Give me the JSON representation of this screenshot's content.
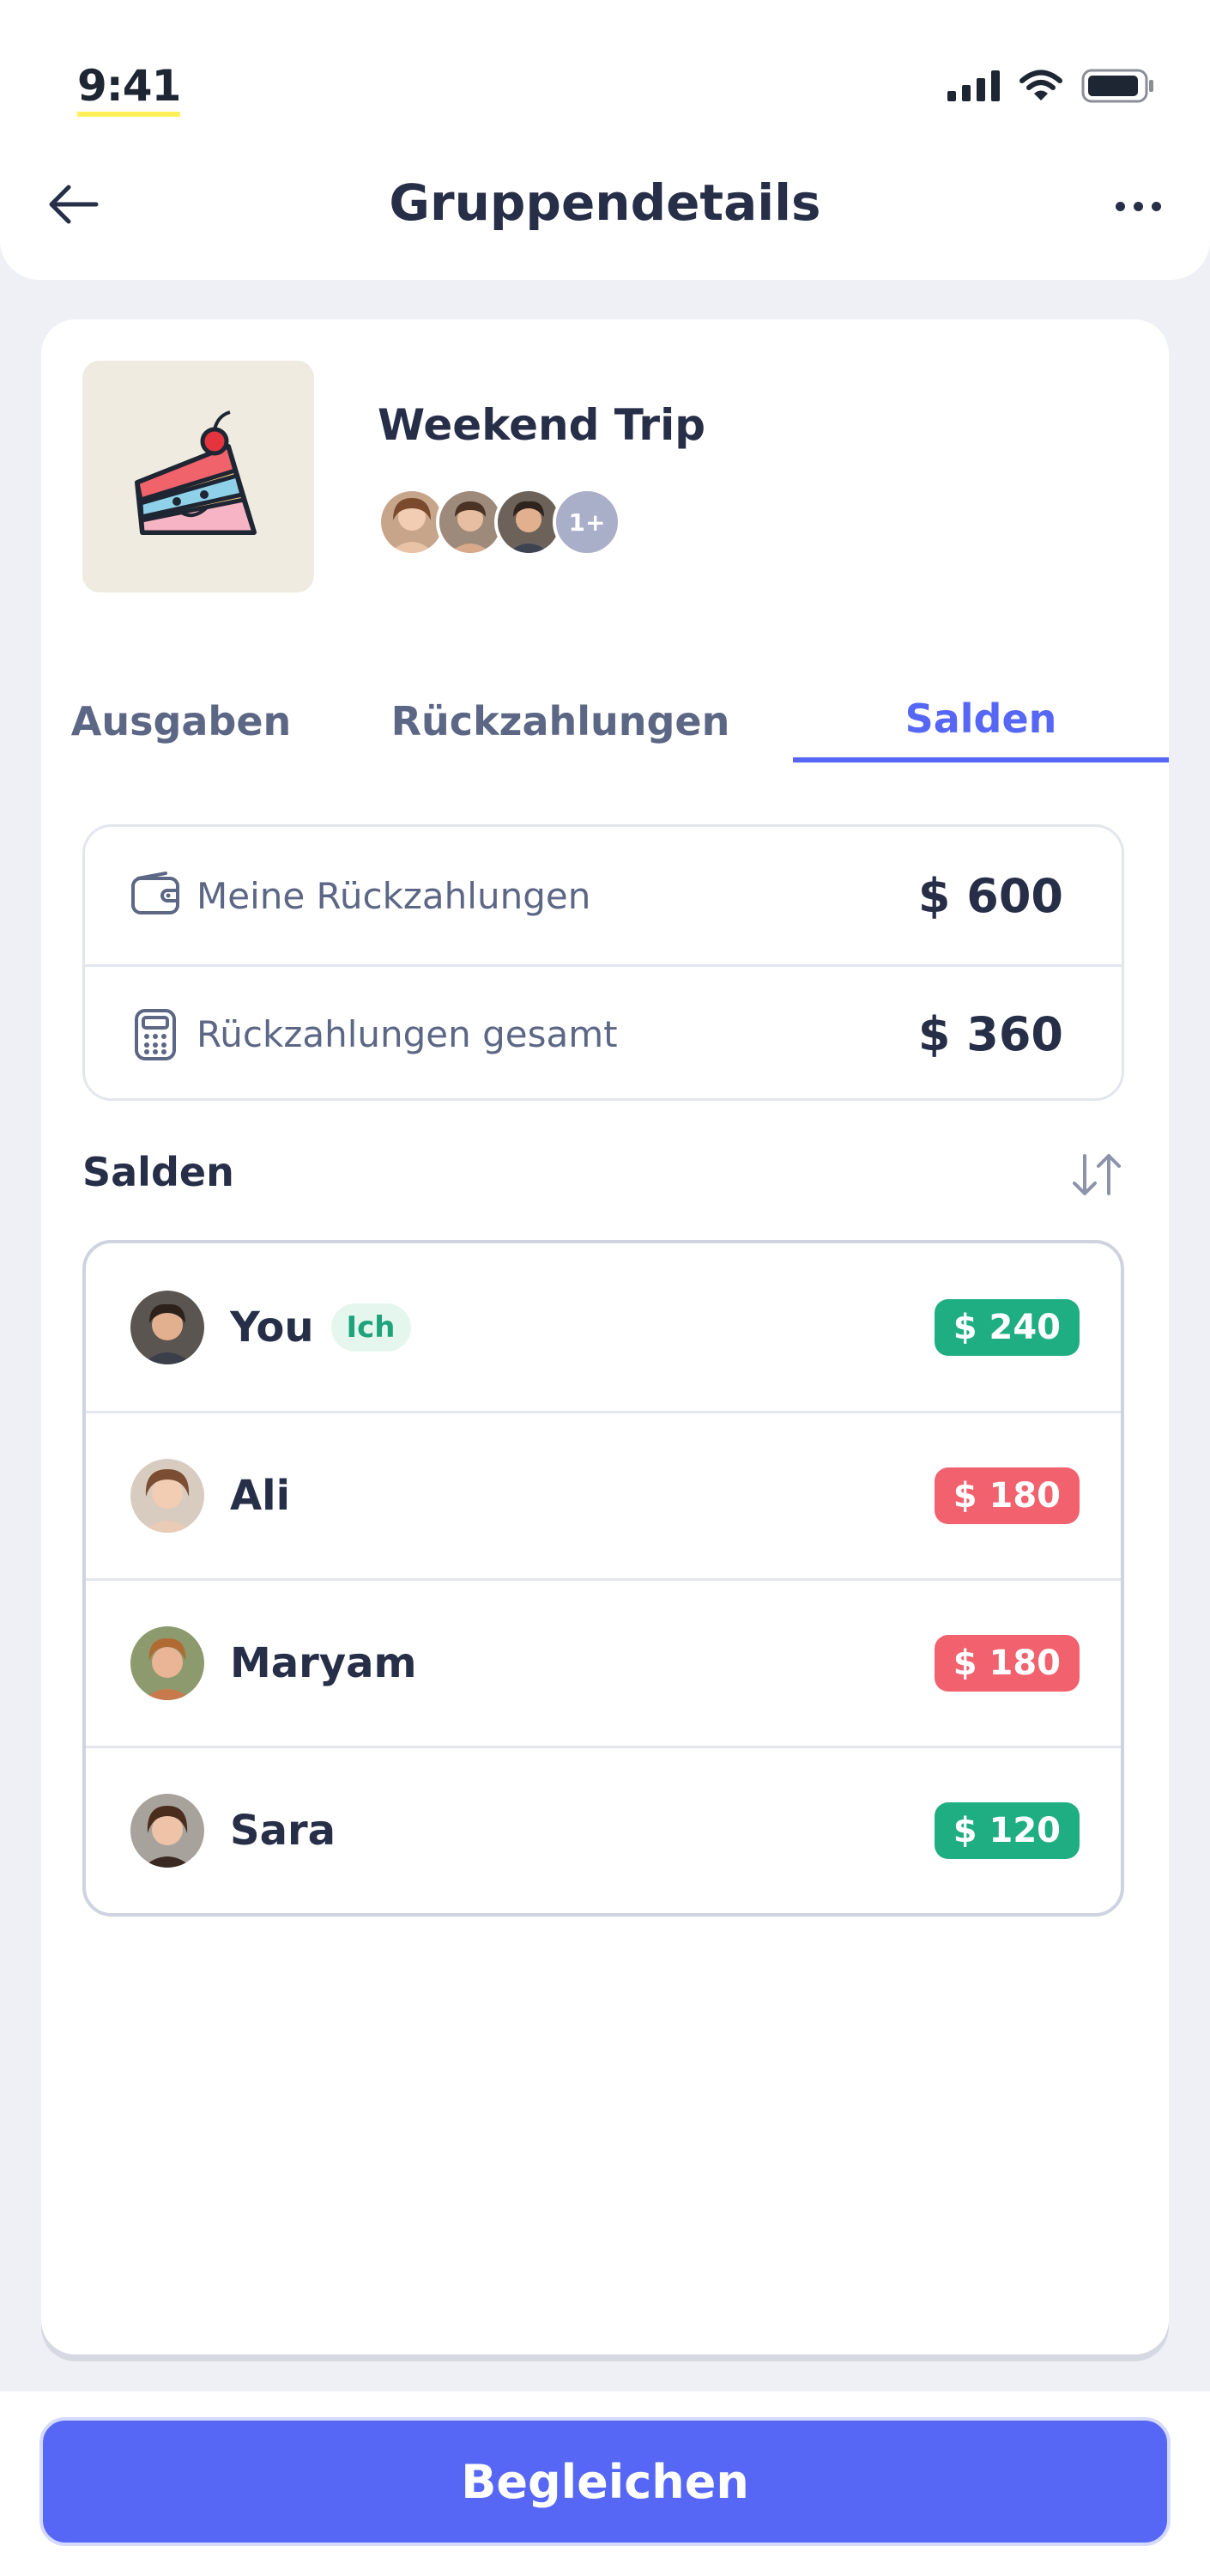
{
  "status_bar": {
    "time": "9:41"
  },
  "header": {
    "title": "Gruppendetails"
  },
  "group": {
    "name": "Weekend Trip",
    "more_members_label": "1+"
  },
  "tabs": [
    {
      "label": "Ausgaben",
      "active": false
    },
    {
      "label": "Rückzahlungen",
      "active": false
    },
    {
      "label": "Salden",
      "active": true
    }
  ],
  "summary": [
    {
      "label": "Meine Rückzahlungen",
      "value": "$ 600",
      "icon": "wallet-icon"
    },
    {
      "label": "Rückzahlungen gesamt",
      "value": "$ 360",
      "icon": "calculator-icon"
    }
  ],
  "balances_section": {
    "title": "Salden"
  },
  "balances": [
    {
      "name": "You",
      "badge": "Ich",
      "amount": "$ 240",
      "status": "positive"
    },
    {
      "name": "Ali",
      "badge": "",
      "amount": "$ 180",
      "status": "negative"
    },
    {
      "name": "Maryam",
      "badge": "",
      "amount": "$ 180",
      "status": "negative"
    },
    {
      "name": "Sara",
      "badge": "",
      "amount": "$ 120",
      "status": "positive"
    }
  ],
  "colors": {
    "accent": "#5667f5",
    "positive": "#1fae82",
    "negative": "#f2616e",
    "text_dark": "#262e48",
    "text_muted": "#5c6785"
  },
  "footer": {
    "settle_label": "Begleichen"
  }
}
